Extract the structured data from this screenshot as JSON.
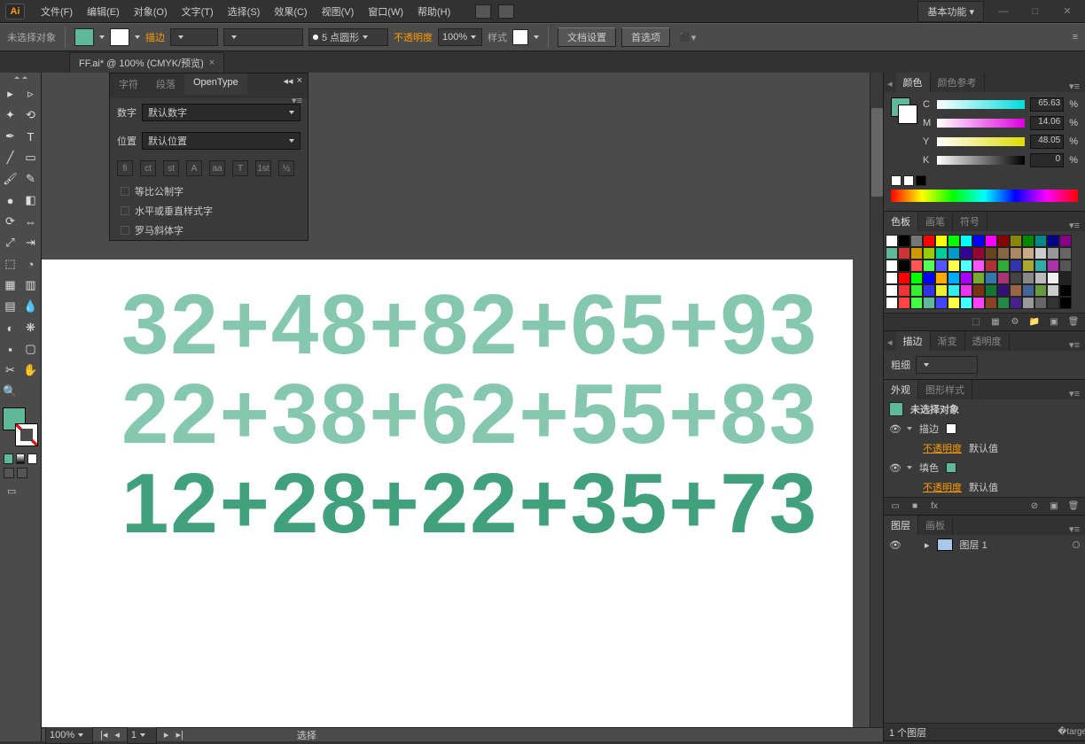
{
  "menu": [
    "文件(F)",
    "编辑(E)",
    "对象(O)",
    "文字(T)",
    "选择(S)",
    "效果(C)",
    "视图(V)",
    "窗口(W)",
    "帮助(H)"
  ],
  "workspace_label": "基本功能",
  "selection_label": "未选择对象",
  "ctrl": {
    "stroke_label": "描边",
    "stroke_pt": "5 点圆形",
    "opacity_label": "不透明度",
    "opacity_val": "100%",
    "style_label": "样式",
    "doc_setup": "文档设置",
    "prefs": "首选项"
  },
  "doc_tab": "FF.ai* @ 100% (CMYK/预览)",
  "ot": {
    "tabs": [
      "字符",
      "段落",
      "OpenType"
    ],
    "num_label": "数字",
    "num_val": "默认数字",
    "pos_label": "位置",
    "pos_val": "默认位置",
    "icons": [
      "fi",
      "ct",
      "st",
      "A",
      "aa",
      "T",
      "1st",
      "½"
    ],
    "checks": [
      "等比公制字",
      "水平或垂直样式字",
      "罗马斜体字"
    ]
  },
  "canvas_lines": [
    {
      "text": "32+48+82+65+93",
      "color": "#86c7b0"
    },
    {
      "text": "22+38+62+55+83",
      "color": "#86c7b0"
    },
    {
      "text": "12+28+22+35+73",
      "color": "#41a07e"
    }
  ],
  "status": {
    "zoom": "100%",
    "page": "1",
    "sel": "选择"
  },
  "colors_panel": {
    "tabs": [
      "颜色",
      "颜色参考"
    ],
    "cmyk": [
      {
        "ch": "C",
        "val": "65.63",
        "grad": "#fff,#0aa"
      },
      {
        "ch": "M",
        "val": "14.06",
        "grad": "#fff,#a0a"
      },
      {
        "ch": "Y",
        "val": "48.05",
        "grad": "#fff,#aa0"
      },
      {
        "ch": "K",
        "val": "0",
        "grad": "#fff,#000"
      }
    ]
  },
  "swatches_panel": {
    "tabs": [
      "色板",
      "画笔",
      "符号"
    ]
  },
  "stroke_panel": {
    "tabs": [
      "描边",
      "渐变",
      "透明度"
    ],
    "weight_label": "粗细"
  },
  "appearance_panel": {
    "tabs": [
      "外观",
      "图形样式"
    ],
    "sel": "未选择对象",
    "stroke": "描边",
    "fill": "填色",
    "opacity": "不透明度",
    "default": "默认值"
  },
  "layers_panel": {
    "tabs": [
      "图层",
      "画板"
    ],
    "layer": "图层 1",
    "count": "1 个图层"
  }
}
